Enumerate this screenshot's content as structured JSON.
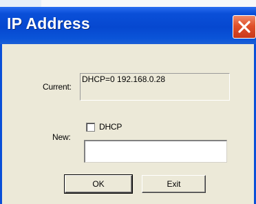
{
  "window": {
    "title": "IP Address"
  },
  "current": {
    "label": "Current:",
    "value": "DHCP=0 192.168.0.28"
  },
  "new": {
    "label": "New:",
    "dhcp_checkbox_label": "DHCP",
    "dhcp_checked": false,
    "address_value": ""
  },
  "buttons": {
    "ok_label": "OK",
    "exit_label": "Exit"
  },
  "icons": {
    "close": "close-icon"
  },
  "colors": {
    "titlebar": "#0a4fd8",
    "close_button": "#e0502a",
    "dialog_face": "#ece9d8"
  }
}
